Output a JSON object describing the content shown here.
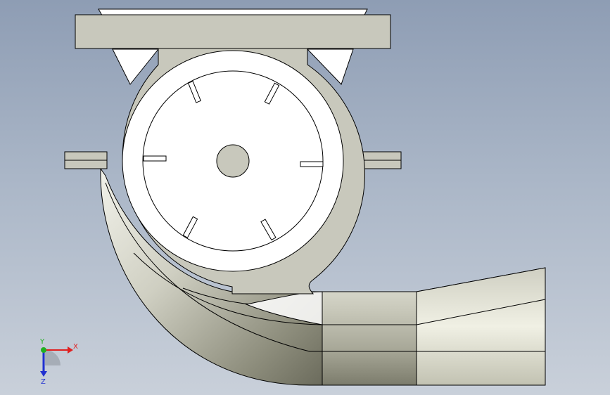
{
  "viewport": {
    "background_top": "#8e9db4",
    "background_bottom": "#c9d0da"
  },
  "model": {
    "body_color": "#c8c8bc",
    "inner_face_color": "#ffffff",
    "outline_color": "#000000"
  },
  "triad": {
    "x_label": "X",
    "y_label": "Y",
    "z_label": "Z",
    "x_color": "#e02020",
    "y_color": "#20b020",
    "z_color": "#2030d0"
  }
}
